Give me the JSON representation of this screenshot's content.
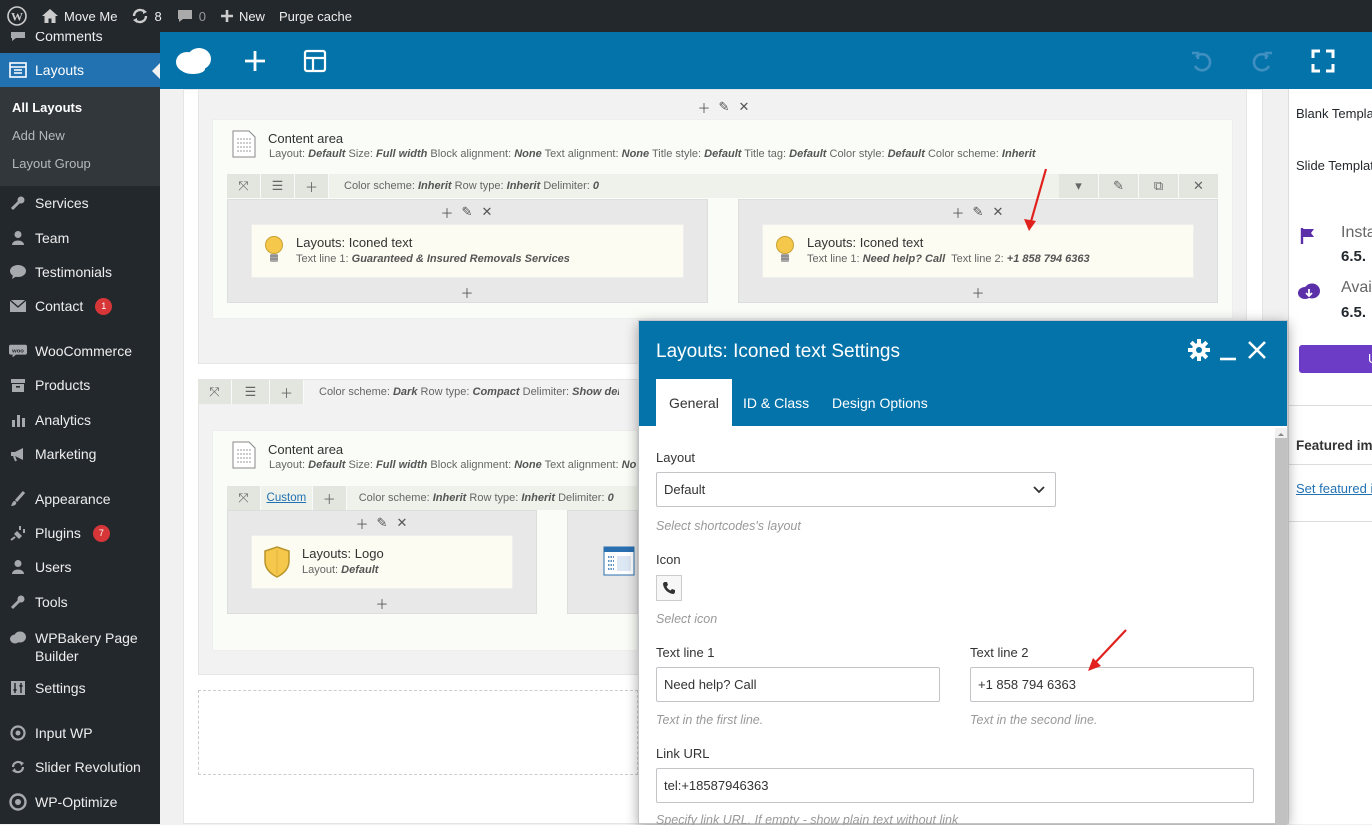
{
  "admin_bar": {
    "site_name": "Move Me",
    "updates_count": "8",
    "comments_count": "0",
    "new_label": "New",
    "purge_label": "Purge cache"
  },
  "sidebar": {
    "comments_label": "Comments",
    "layouts_label": "Layouts",
    "submenu": [
      "All Layouts",
      "Add New",
      "Layout Group"
    ],
    "items": [
      {
        "label": "Services",
        "icon": "wrench-icon"
      },
      {
        "label": "Team",
        "icon": "user-icon"
      },
      {
        "label": "Testimonials",
        "icon": "speech-bubble-icon"
      },
      {
        "label": "Contact",
        "icon": "envelope-icon",
        "badge": "1"
      },
      {
        "label": "WooCommerce",
        "icon": "woo-icon"
      },
      {
        "label": "Products",
        "icon": "archive-icon"
      },
      {
        "label": "Analytics",
        "icon": "bar-chart-icon"
      },
      {
        "label": "Marketing",
        "icon": "megaphone-icon"
      },
      {
        "label": "Appearance",
        "icon": "paintbrush-icon"
      },
      {
        "label": "Plugins",
        "icon": "plug-icon",
        "badge": "7"
      },
      {
        "label": "Users",
        "icon": "user-icon"
      },
      {
        "label": "Tools",
        "icon": "wrench-icon"
      },
      {
        "label": "WPBakery Page Builder",
        "icon": "cloud-icon"
      },
      {
        "label": "Settings",
        "icon": "sliders-icon"
      },
      {
        "label": "Input WP",
        "icon": "circle-icon"
      },
      {
        "label": "Slider Revolution",
        "icon": "refresh-icon"
      },
      {
        "label": "WP-Optimize",
        "icon": "optimize-icon"
      }
    ]
  },
  "builder": {
    "section1": {
      "title": "Content area",
      "params": [
        [
          "Layout",
          "Default"
        ],
        [
          "Size",
          "Full width"
        ],
        [
          "Block alignment",
          "None"
        ],
        [
          "Text alignment",
          "None"
        ],
        [
          "Title style",
          "Default"
        ],
        [
          "Title tag",
          "Default"
        ],
        [
          "Color style",
          "Default"
        ],
        [
          "Color scheme",
          "Inherit"
        ]
      ],
      "row_params": [
        [
          "Color scheme",
          "Inherit"
        ],
        [
          "Row type",
          "Inherit"
        ],
        [
          "Delimiter",
          "0"
        ]
      ],
      "left_card": {
        "title": "Layouts: Iconed text",
        "line1_key": "Text line 1",
        "line1_val": "Guaranteed & Insured Removals Services"
      },
      "right_card": {
        "title": "Layouts: Iconed text",
        "line1_key": "Text line 1",
        "line1_val": "Need help? Call",
        "line2_key": "Text line 2",
        "line2_val": "+1 858 794 6363"
      }
    },
    "row2_params": [
      [
        "Color scheme",
        "Dark"
      ],
      [
        "Row type",
        "Compact"
      ],
      [
        "Delimiter",
        "Show delim"
      ]
    ],
    "section2": {
      "title": "Content area",
      "params": [
        [
          "Layout",
          "Default"
        ],
        [
          "Size",
          "Full width"
        ],
        [
          "Block alignment",
          "None"
        ],
        [
          "Text alignment",
          "No"
        ]
      ],
      "custom_label": "Custom",
      "row_params": [
        [
          "Color scheme",
          "Inherit"
        ],
        [
          "Row type",
          "Inherit"
        ],
        [
          "Delimiter",
          "0"
        ]
      ],
      "logo_card": {
        "title": "Layouts: Logo",
        "line_key": "Layout",
        "line_val": "Default"
      }
    }
  },
  "right_panel": {
    "blank_template": "Blank Templa",
    "slide_template": "Slide Templat",
    "install_label": "Insta",
    "install_version": "6.5.",
    "available_label": "Avai",
    "available_version": "6.5.",
    "button_label": "U",
    "featured_title": "Featured ima",
    "featured_link": "Set featured i"
  },
  "modal": {
    "title": "Layouts: Iconed text Settings",
    "tabs": [
      "General",
      "ID & Class",
      "Design Options"
    ],
    "layout_label": "Layout",
    "layout_value": "Default",
    "layout_help": "Select shortcodes's layout",
    "icon_label": "Icon",
    "icon_help": "Select icon",
    "text1_label": "Text line 1",
    "text1_value": "Need help? Call",
    "text1_help": "Text in the first line.",
    "text2_label": "Text line 2",
    "text2_value": "+1 858 794 6363",
    "text2_help": "Text in the second line.",
    "link_label": "Link URL",
    "link_value": "tel:+18587946363",
    "link_help": "Specify link URL. If empty - show plain text without link"
  },
  "colors": {
    "admin_dark": "#23282d",
    "wp_blue": "#2271b1",
    "builder_blue": "#0473aa",
    "badge_red": "#d63638",
    "arrow_red": "#e0211d"
  }
}
